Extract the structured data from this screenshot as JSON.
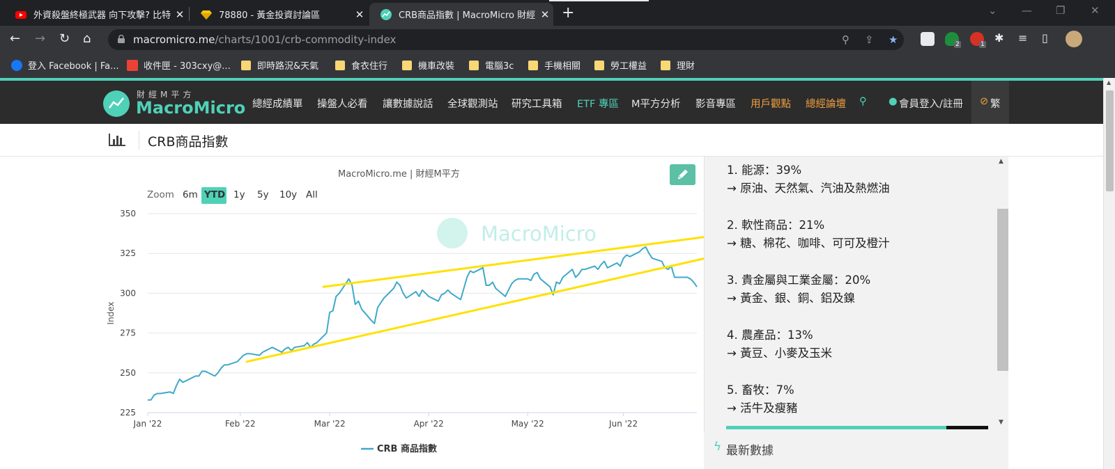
{
  "browser": {
    "tabs": [
      {
        "title": "外資殺盤終極武器 向下攻擊? 比特",
        "favicon": "youtube-icon"
      },
      {
        "title": "78880 - 黃金投資討論區",
        "favicon": "gem-icon"
      },
      {
        "title": "CRB商品指數 | MacroMicro 財經",
        "favicon": "macromicro-icon",
        "active": true
      }
    ],
    "url_host": "macromicro.me",
    "url_path": "/charts/1001/crb-commodity-index",
    "extension_badges": [
      "2",
      "1"
    ],
    "bookmarks": [
      {
        "label": "登入 Facebook | Fa...",
        "icon": "facebook-icon"
      },
      {
        "label": "收件匣 - 303cxy@...",
        "icon": "gmail-icon"
      },
      {
        "label": "即時路況&天氣",
        "icon": "folder-icon"
      },
      {
        "label": "食衣住行",
        "icon": "folder-icon"
      },
      {
        "label": "機車改裝",
        "icon": "folder-icon"
      },
      {
        "label": "電腦3c",
        "icon": "folder-icon"
      },
      {
        "label": "手機相關",
        "icon": "folder-icon"
      },
      {
        "label": "勞工權益",
        "icon": "folder-icon"
      },
      {
        "label": "理財",
        "icon": "folder-icon"
      }
    ]
  },
  "site": {
    "logo_cn": "財經M平方",
    "logo_en": "MacroMicro",
    "menu": [
      {
        "label": "總經成績單",
        "style": "normal"
      },
      {
        "label": "操盤人必看",
        "style": "normal"
      },
      {
        "label": "讓數據說話",
        "style": "normal"
      },
      {
        "label": "全球觀測站",
        "style": "normal"
      },
      {
        "label": "研究工具箱",
        "style": "normal"
      },
      {
        "label": "ETF 專區",
        "style": "teal"
      },
      {
        "label": "M平方分析",
        "style": "normal"
      },
      {
        "label": "影音專區",
        "style": "normal"
      },
      {
        "label": "用戶觀點",
        "style": "orange"
      },
      {
        "label": "總經論壇",
        "style": "orange"
      }
    ],
    "login_label": "會員登入/註冊",
    "lang_label": "繁",
    "accent": "#4fd1b8"
  },
  "page": {
    "title": "CRB商品指數",
    "chart_credit": "MacroMicro.me | 財經M平方",
    "watermark": "MacroMicro",
    "zoom_label": "Zoom",
    "zoom_options": [
      "6m",
      "YTD",
      "1y",
      "5y",
      "10y",
      "All"
    ],
    "zoom_selected": "YTD",
    "info_lines": [
      "1. 能源：39%",
      "→ 原油、天然氣、汽油及熱燃油",
      "2. 軟性商品：21%",
      "→ 糖、棉花、咖啡、可可及橙汁",
      "3. 貴金屬與工業金屬：20%",
      "→ 黃金、銀、銅、鋁及鎳",
      "4. 農產品：13%",
      "→ 黃豆、小麥及玉米",
      "5. 畜牧：7%",
      "→ 活牛及瘦豬"
    ],
    "latest_data_label": "最新數據"
  },
  "chart_data": {
    "type": "line",
    "ylabel": "Index",
    "ylim": [
      225,
      350
    ],
    "yticks": [
      225,
      250,
      275,
      300,
      325,
      350
    ],
    "xticks": [
      "Jan '22",
      "Feb '22",
      "Mar '22",
      "Apr '22",
      "May '22",
      "Jun '22"
    ],
    "xrange": [
      "2022-01-03",
      "2022-06-24"
    ],
    "grid": true,
    "legend_position": "bottom-center",
    "series": [
      {
        "name": "CRB 商品指數",
        "color": "#3fa9c9",
        "points": [
          [
            "2022-01-03",
            233
          ],
          [
            "2022-01-04",
            233
          ],
          [
            "2022-01-05",
            236
          ],
          [
            "2022-01-06",
            237
          ],
          [
            "2022-01-07",
            237
          ],
          [
            "2022-01-10",
            238
          ],
          [
            "2022-01-11",
            237
          ],
          [
            "2022-01-12",
            242
          ],
          [
            "2022-01-13",
            246
          ],
          [
            "2022-01-14",
            244
          ],
          [
            "2022-01-17",
            247
          ],
          [
            "2022-01-18",
            248
          ],
          [
            "2022-01-19",
            248
          ],
          [
            "2022-01-20",
            251
          ],
          [
            "2022-01-21",
            251
          ],
          [
            "2022-01-24",
            248
          ],
          [
            "2022-01-25",
            250
          ],
          [
            "2022-01-26",
            253
          ],
          [
            "2022-01-27",
            255
          ],
          [
            "2022-01-28",
            255
          ],
          [
            "2022-01-31",
            257
          ],
          [
            "2022-02-01",
            259
          ],
          [
            "2022-02-02",
            261
          ],
          [
            "2022-02-03",
            262
          ],
          [
            "2022-02-04",
            262
          ],
          [
            "2022-02-07",
            261
          ],
          [
            "2022-02-08",
            263
          ],
          [
            "2022-02-09",
            264
          ],
          [
            "2022-02-10",
            265
          ],
          [
            "2022-02-11",
            266
          ],
          [
            "2022-02-14",
            263
          ],
          [
            "2022-02-15",
            265
          ],
          [
            "2022-02-16",
            266
          ],
          [
            "2022-02-17",
            264
          ],
          [
            "2022-02-18",
            266
          ],
          [
            "2022-02-21",
            267
          ],
          [
            "2022-02-22",
            269
          ],
          [
            "2022-02-23",
            266
          ],
          [
            "2022-02-24",
            268
          ],
          [
            "2022-02-25",
            269
          ],
          [
            "2022-02-28",
            275
          ],
          [
            "2022-03-01",
            288
          ],
          [
            "2022-03-02",
            289
          ],
          [
            "2022-03-03",
            298
          ],
          [
            "2022-03-04",
            300
          ],
          [
            "2022-03-07",
            309
          ],
          [
            "2022-03-08",
            305
          ],
          [
            "2022-03-09",
            293
          ],
          [
            "2022-03-10",
            295
          ],
          [
            "2022-03-11",
            290
          ],
          [
            "2022-03-14",
            283
          ],
          [
            "2022-03-15",
            281
          ],
          [
            "2022-03-16",
            291
          ],
          [
            "2022-03-17",
            294
          ],
          [
            "2022-03-18",
            297
          ],
          [
            "2022-03-21",
            303
          ],
          [
            "2022-03-22",
            307
          ],
          [
            "2022-03-23",
            305
          ],
          [
            "2022-03-24",
            300
          ],
          [
            "2022-03-25",
            297
          ],
          [
            "2022-03-28",
            301
          ],
          [
            "2022-03-29",
            298
          ],
          [
            "2022-03-30",
            302
          ],
          [
            "2022-03-31",
            300
          ],
          [
            "2022-04-01",
            298
          ],
          [
            "2022-04-04",
            295
          ],
          [
            "2022-04-05",
            299
          ],
          [
            "2022-04-06",
            300
          ],
          [
            "2022-04-07",
            302
          ],
          [
            "2022-04-08",
            300
          ],
          [
            "2022-04-11",
            296
          ],
          [
            "2022-04-12",
            303
          ],
          [
            "2022-04-13",
            310
          ],
          [
            "2022-04-14",
            314
          ],
          [
            "2022-04-15",
            313
          ],
          [
            "2022-04-18",
            316
          ],
          [
            "2022-04-19",
            305
          ],
          [
            "2022-04-20",
            305
          ],
          [
            "2022-04-21",
            307
          ],
          [
            "2022-04-22",
            303
          ],
          [
            "2022-04-25",
            298
          ],
          [
            "2022-04-26",
            302
          ],
          [
            "2022-04-27",
            306
          ],
          [
            "2022-04-28",
            308
          ],
          [
            "2022-04-29",
            309
          ],
          [
            "2022-05-02",
            309
          ],
          [
            "2022-05-03",
            308
          ],
          [
            "2022-05-04",
            312
          ],
          [
            "2022-05-05",
            313
          ],
          [
            "2022-05-06",
            309
          ],
          [
            "2022-05-09",
            304
          ],
          [
            "2022-05-10",
            299
          ],
          [
            "2022-05-11",
            307
          ],
          [
            "2022-05-12",
            306
          ],
          [
            "2022-05-13",
            310
          ],
          [
            "2022-05-16",
            315
          ],
          [
            "2022-05-17",
            310
          ],
          [
            "2022-05-18",
            312
          ],
          [
            "2022-05-19",
            315
          ],
          [
            "2022-05-20",
            315
          ],
          [
            "2022-05-23",
            317
          ],
          [
            "2022-05-24",
            315
          ],
          [
            "2022-05-25",
            318
          ],
          [
            "2022-05-26",
            320
          ],
          [
            "2022-05-27",
            316
          ],
          [
            "2022-05-30",
            319
          ],
          [
            "2022-05-31",
            317
          ],
          [
            "2022-06-01",
            322
          ],
          [
            "2022-06-02",
            324
          ],
          [
            "2022-06-03",
            323
          ],
          [
            "2022-06-06",
            326
          ],
          [
            "2022-06-07",
            328
          ],
          [
            "2022-06-08",
            329
          ],
          [
            "2022-06-09",
            325
          ],
          [
            "2022-06-10",
            322
          ],
          [
            "2022-06-13",
            320
          ],
          [
            "2022-06-14",
            316
          ],
          [
            "2022-06-15",
            315
          ],
          [
            "2022-06-16",
            317
          ],
          [
            "2022-06-17",
            310
          ],
          [
            "2022-06-20",
            310
          ],
          [
            "2022-06-21",
            310
          ],
          [
            "2022-06-22",
            309
          ],
          [
            "2022-06-23",
            307
          ],
          [
            "2022-06-24",
            304
          ]
        ]
      }
    ],
    "trendlines": [
      {
        "color": "#ffe100",
        "from": [
          "2022-02-03",
          257
        ],
        "to": [
          "2022-06-29",
          323
        ]
      },
      {
        "color": "#ffe100",
        "from": [
          "2022-02-27",
          304
        ],
        "to": [
          "2022-06-29",
          336
        ]
      }
    ]
  }
}
